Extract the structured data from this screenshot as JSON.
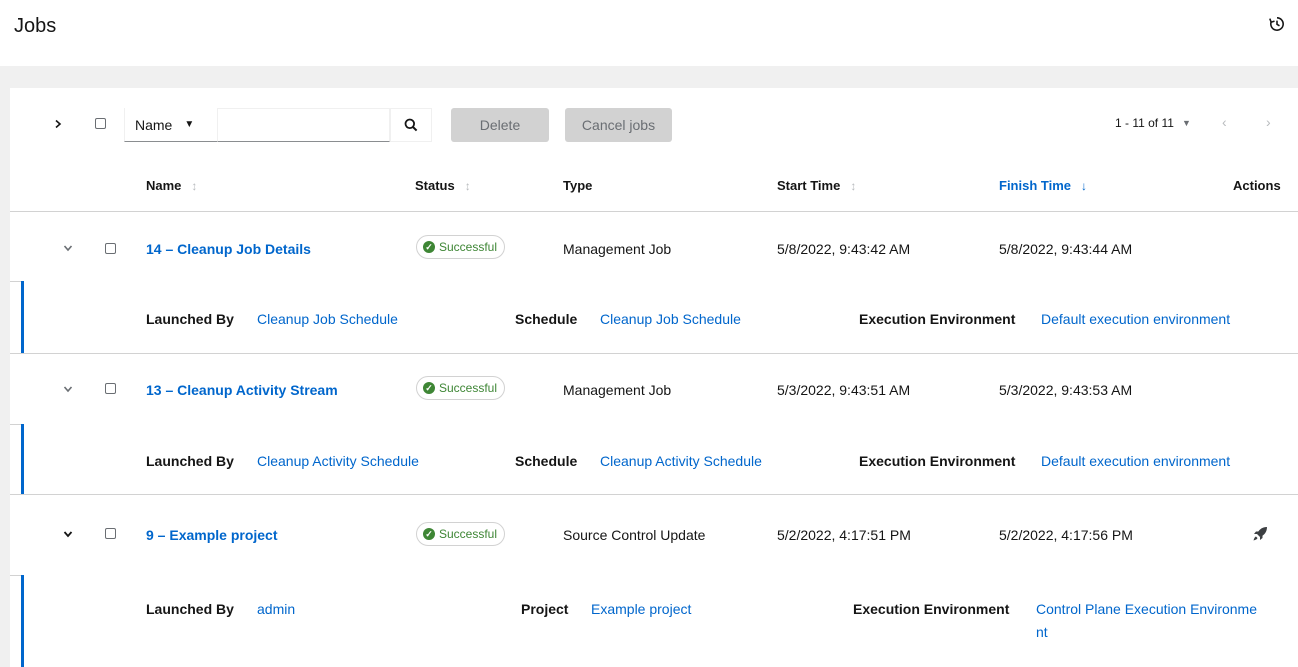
{
  "page": {
    "title": "Jobs"
  },
  "toolbar": {
    "filter_select": "Name",
    "search_placeholder": "",
    "delete_label": "Delete",
    "cancel_label": "Cancel jobs",
    "pagination_text": "1 - 11 of 11"
  },
  "columns": {
    "name": "Name",
    "status": "Status",
    "type": "Type",
    "start_time": "Start Time",
    "finish_time": "Finish Time",
    "actions": "Actions"
  },
  "jobs": [
    {
      "name": "14 – Cleanup Job Details",
      "status": "Successful",
      "type": "Management Job",
      "start_time": "5/8/2022, 9:43:42 AM",
      "finish_time": "5/8/2022, 9:43:44 AM",
      "details": {
        "launched_by_label": "Launched By",
        "launched_by": "Cleanup Job Schedule",
        "second_label": "Schedule",
        "second_value": "Cleanup Job Schedule",
        "ee_label": "Execution Environment",
        "ee_value": "Default execution environment"
      }
    },
    {
      "name": "13 – Cleanup Activity Stream",
      "status": "Successful",
      "type": "Management Job",
      "start_time": "5/3/2022, 9:43:51 AM",
      "finish_time": "5/3/2022, 9:43:53 AM",
      "details": {
        "launched_by_label": "Launched By",
        "launched_by": "Cleanup Activity Schedule",
        "second_label": "Schedule",
        "second_value": "Cleanup Activity Schedule",
        "ee_label": "Execution Environment",
        "ee_value": "Default execution environment"
      }
    },
    {
      "name": "9 – Example project",
      "status": "Successful",
      "type": "Source Control Update",
      "start_time": "5/2/2022, 4:17:51 PM",
      "finish_time": "5/2/2022, 4:17:56 PM",
      "details": {
        "launched_by_label": "Launched By",
        "launched_by": "admin",
        "second_label": "Project",
        "second_value": "Example project",
        "ee_label": "Execution Environment",
        "ee_value_line1": "Control Plane Execution Environme",
        "ee_value_line2": "nt"
      }
    }
  ],
  "colors": {
    "link": "#0066cc",
    "success": "#3e8635",
    "accent_border": "#0066cc"
  }
}
